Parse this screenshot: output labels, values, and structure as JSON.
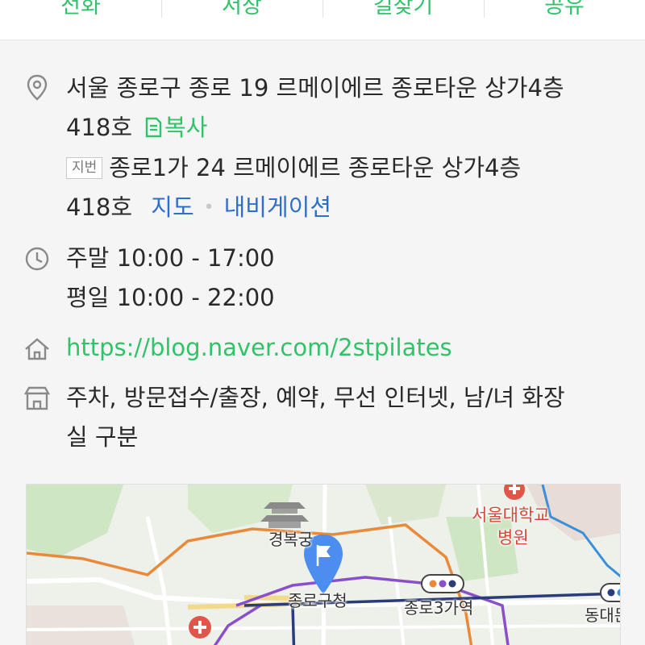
{
  "actions": {
    "call": "전화",
    "save": "저장",
    "directions": "길찾기",
    "share": "공유"
  },
  "address": {
    "road_line1": "서울 종로구 종로 19 르메이에르 종로타운 상가4층",
    "road_line2": "418호",
    "copy": "복사",
    "jibun_tag": "지번",
    "jibun_line1": "종로1가 24 르메이에르 종로타운 상가4층",
    "jibun_line2": "418호",
    "map_link": "지도",
    "navigation_link": "내비게이션"
  },
  "hours": {
    "weekend": "주말 10:00 - 17:00",
    "weekday": "평일 10:00 - 22:00"
  },
  "website": "https://blog.naver.com/2stpilates",
  "amenities": {
    "line1": "주차, 방문접수/출장, 예약, 무선 인터넷, 남/녀 화장",
    "line2": "실 구분"
  },
  "map": {
    "labels": {
      "gyeongbokgung": "경복궁",
      "hospital": "서울대학교",
      "hospital2": "병원",
      "jongno_office": "종로구청",
      "jongno3": "종로3가역",
      "dongdaemun": "동대문"
    }
  },
  "colors": {
    "accent_green": "#31c36a",
    "link_blue": "#2f6fc9"
  }
}
